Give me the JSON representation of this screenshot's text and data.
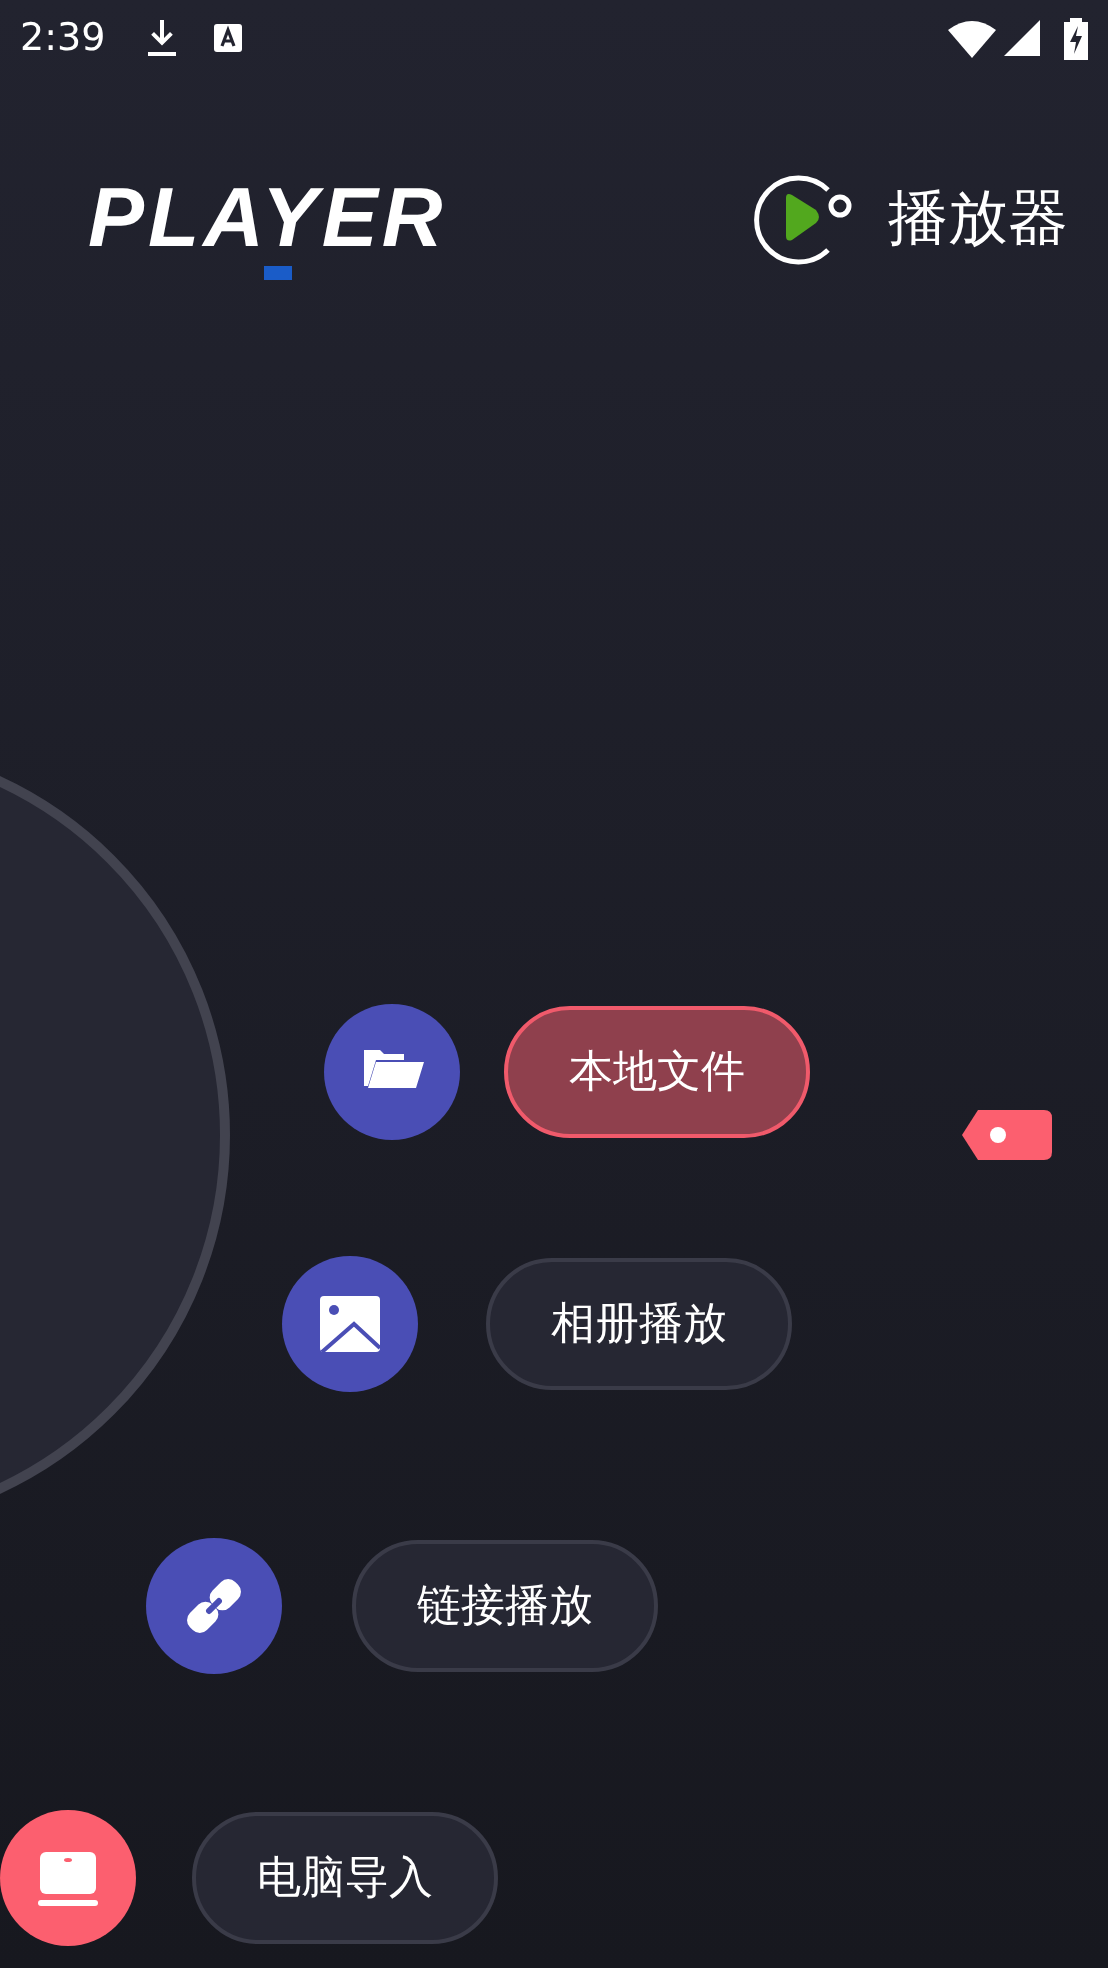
{
  "status_bar": {
    "time": "2:39"
  },
  "header": {
    "logo": "PLAYER",
    "title": "播放器"
  },
  "menu": [
    {
      "label": "本地文件",
      "selected": true,
      "kind": "folder",
      "color": "#4a4eb5"
    },
    {
      "label": "相册播放",
      "selected": false,
      "kind": "image",
      "color": "#4a4eb5"
    },
    {
      "label": "链接播放",
      "selected": false,
      "kind": "link",
      "color": "#4a4eb5"
    },
    {
      "label": "电脑导入",
      "selected": false,
      "kind": "laptop",
      "color": "#fc5f6f"
    }
  ]
}
